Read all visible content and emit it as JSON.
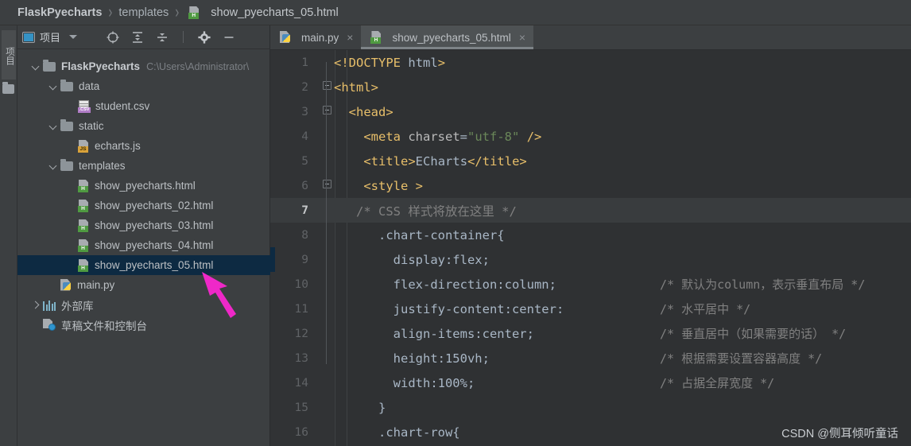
{
  "breadcrumb": {
    "root": "FlaskPyecharts",
    "folder": "templates",
    "file": "show_pyecharts_05.html",
    "separator": "›"
  },
  "toolstrip": {
    "vertical_tab_label": "项目"
  },
  "project_panel": {
    "title": "项目",
    "toolbar_icons": [
      "locate-target-icon",
      "expand-all-icon",
      "collapse-all-icon",
      "settings-gear-icon",
      "hide-panel-icon"
    ],
    "tree": [
      {
        "indent": 0,
        "twisty": "down",
        "icon": "folder-icon",
        "name": "FlaskPyecharts",
        "bold": true,
        "path": "C:\\Users\\Administrator\\",
        "selected": false
      },
      {
        "indent": 1,
        "twisty": "down",
        "icon": "folder-icon",
        "name": "data",
        "bold": false,
        "path": "",
        "selected": false
      },
      {
        "indent": 2,
        "twisty": "none",
        "icon": "csv-file-icon",
        "name": "student.csv",
        "bold": false,
        "path": "",
        "selected": false
      },
      {
        "indent": 1,
        "twisty": "down",
        "icon": "folder-icon",
        "name": "static",
        "bold": false,
        "path": "",
        "selected": false
      },
      {
        "indent": 2,
        "twisty": "none",
        "icon": "js-file-icon",
        "name": "echarts.js",
        "bold": false,
        "path": "",
        "selected": false
      },
      {
        "indent": 1,
        "twisty": "down",
        "icon": "folder-icon",
        "name": "templates",
        "bold": false,
        "path": "",
        "selected": false
      },
      {
        "indent": 2,
        "twisty": "none",
        "icon": "html-file-icon",
        "name": "show_pyecharts.html",
        "bold": false,
        "path": "",
        "selected": false
      },
      {
        "indent": 2,
        "twisty": "none",
        "icon": "html-file-icon",
        "name": "show_pyecharts_02.html",
        "bold": false,
        "path": "",
        "selected": false
      },
      {
        "indent": 2,
        "twisty": "none",
        "icon": "html-file-icon",
        "name": "show_pyecharts_03.html",
        "bold": false,
        "path": "",
        "selected": false
      },
      {
        "indent": 2,
        "twisty": "none",
        "icon": "html-file-icon",
        "name": "show_pyecharts_04.html",
        "bold": false,
        "path": "",
        "selected": false
      },
      {
        "indent": 2,
        "twisty": "none",
        "icon": "html-file-icon",
        "name": "show_pyecharts_05.html",
        "bold": false,
        "path": "",
        "selected": true
      },
      {
        "indent": 1,
        "twisty": "none",
        "icon": "python-file-icon",
        "name": "main.py",
        "bold": false,
        "path": "",
        "selected": false
      },
      {
        "indent": 0,
        "twisty": "right",
        "icon": "library-icon",
        "name": "外部库",
        "bold": false,
        "path": "",
        "selected": false
      },
      {
        "indent": 0,
        "twisty": "none",
        "icon": "console-icon",
        "name": "草稿文件和控制台",
        "bold": false,
        "path": "",
        "selected": false
      }
    ]
  },
  "editor": {
    "tabs": [
      {
        "label": "main.py",
        "icon": "python-file-icon",
        "active": false,
        "close": "×"
      },
      {
        "label": "show_pyecharts_05.html",
        "icon": "html-file-icon",
        "active": true,
        "close": "×"
      }
    ],
    "lines": [
      {
        "num": "1",
        "fold": false,
        "current": false,
        "code": "<!DOCTYPE html>",
        "comment": ""
      },
      {
        "num": "2",
        "fold": true,
        "current": false,
        "code": "<html>",
        "comment": ""
      },
      {
        "num": "3",
        "fold": true,
        "current": false,
        "code": "  <head>",
        "comment": ""
      },
      {
        "num": "4",
        "fold": false,
        "current": false,
        "code": "    <meta charset=\"utf-8\" />",
        "comment": ""
      },
      {
        "num": "5",
        "fold": false,
        "current": false,
        "code": "    <title>ECharts</title>",
        "comment": ""
      },
      {
        "num": "6",
        "fold": true,
        "current": false,
        "code": "    <style >",
        "comment": ""
      },
      {
        "num": "7",
        "fold": false,
        "current": true,
        "code": "   /* CSS 样式将放在这里 */",
        "comment": ""
      },
      {
        "num": "8",
        "fold": false,
        "current": false,
        "code": "      .chart-container{",
        "comment": ""
      },
      {
        "num": "9",
        "fold": false,
        "current": false,
        "code": "        display:flex;",
        "comment": ""
      },
      {
        "num": "10",
        "fold": false,
        "current": false,
        "code": "        flex-direction:column;",
        "comment": "/* 默认为column，表示垂直布局 */"
      },
      {
        "num": "11",
        "fold": false,
        "current": false,
        "code": "        justify-content:center:",
        "comment": "/* 水平居中 */"
      },
      {
        "num": "12",
        "fold": false,
        "current": false,
        "code": "        align-items:center;",
        "comment": "/* 垂直居中（如果需要的话） */"
      },
      {
        "num": "13",
        "fold": false,
        "current": false,
        "code": "        height:150vh;",
        "comment": "/* 根据需要设置容器高度 */"
      },
      {
        "num": "14",
        "fold": false,
        "current": false,
        "code": "        width:100%;",
        "comment": "/* 占据全屏宽度 */"
      },
      {
        "num": "15",
        "fold": false,
        "current": false,
        "code": "      }",
        "comment": ""
      },
      {
        "num": "16",
        "fold": false,
        "current": false,
        "code": "      .chart-row{",
        "comment": ""
      }
    ]
  },
  "annotation": {
    "arrow_color": "#ef28c8"
  },
  "watermark": "CSDN @侧耳倾听童话",
  "colors": {
    "window_bg": "#3c3f41",
    "editor_bg": "#2f3133",
    "gutter_bg": "#313335",
    "selection_bg": "#0d2a42",
    "current_line_bg": "#393c3e",
    "tag_color": "#e8bf6a",
    "string_color": "#6a8759",
    "comment_color": "#808080",
    "text_color": "#a9b7c6"
  }
}
